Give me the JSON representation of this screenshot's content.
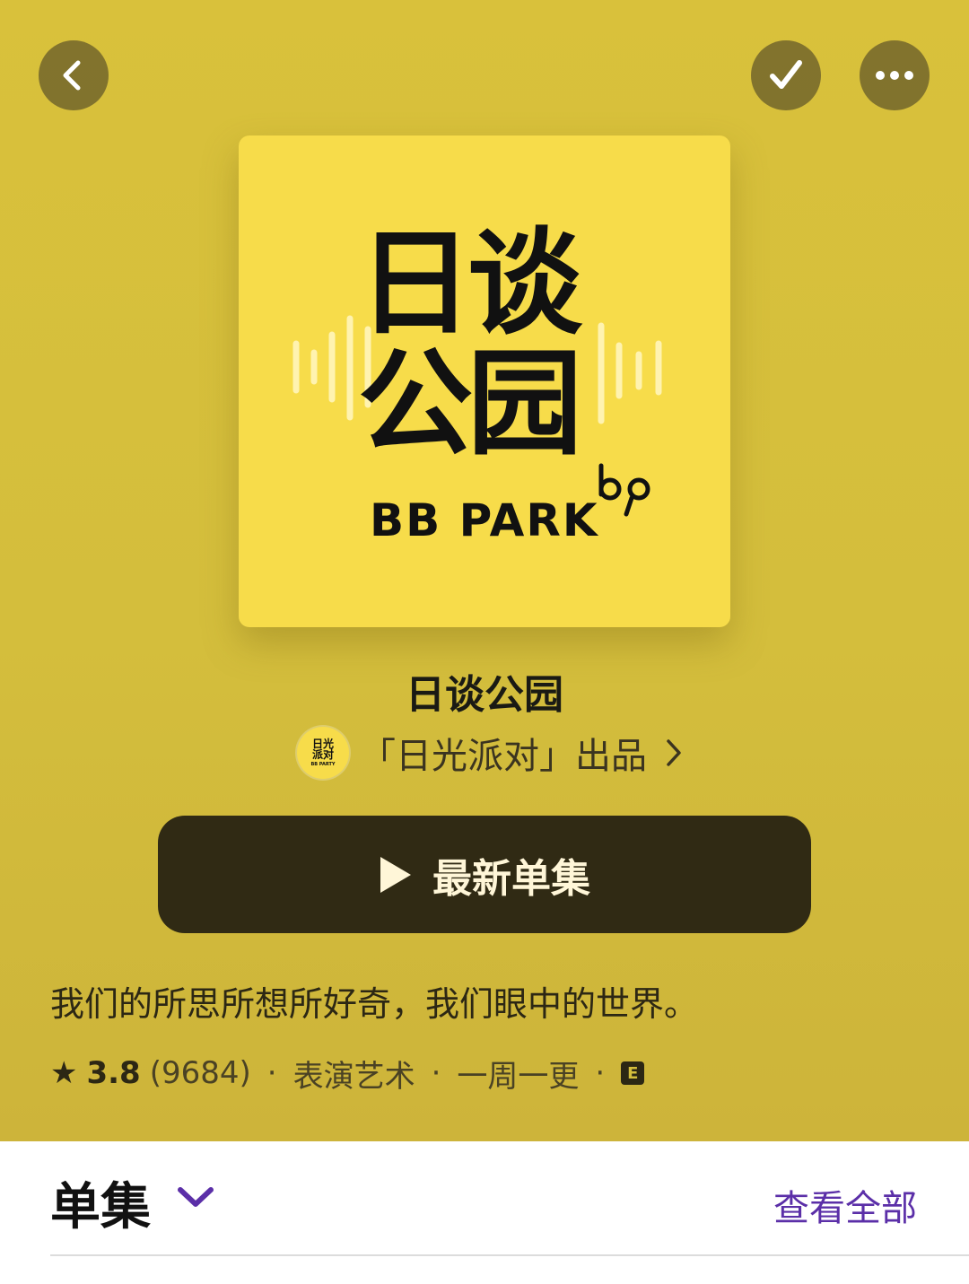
{
  "colors": {
    "hero_bg": "#d4be3c",
    "artwork_bg": "#f7dc4a",
    "play_button_bg": "#302a14",
    "accent_link": "#5b2fa8"
  },
  "nav": {
    "back_icon": "chevron-left-icon",
    "check_icon": "checkmark-icon",
    "more_icon": "ellipsis-icon"
  },
  "artwork": {
    "title_line1": "日谈",
    "title_line2": "公园",
    "brand": "BB PARK",
    "logo_mark": "bp"
  },
  "show": {
    "title": "日谈公园",
    "publisher_logo_line1": "日光\n派对",
    "publisher_logo_line2": "BB PARTY",
    "publisher": "「日光派对」出品"
  },
  "play_button": {
    "label": "最新单集"
  },
  "description": "我们的所思所想所好奇，我们眼中的世界。",
  "meta": {
    "rating": "3.8",
    "rating_count": "(9684)",
    "category": "表演艺术",
    "frequency": "一周一更",
    "explicit_badge": "E",
    "separator": "·"
  },
  "episodes": {
    "section_title": "单集",
    "see_all": "查看全部"
  }
}
